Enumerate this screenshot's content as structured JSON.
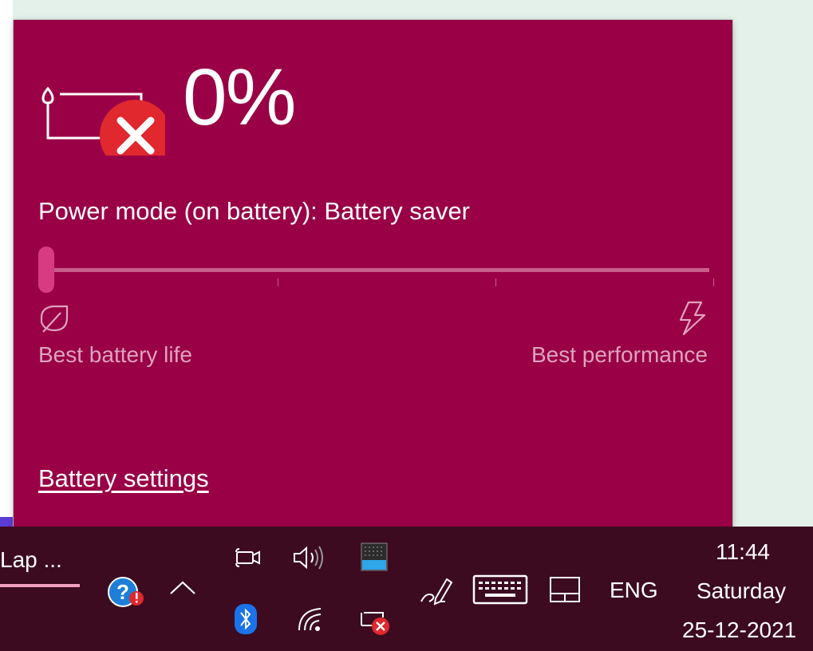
{
  "flyout": {
    "battery_percent": "0%",
    "power_mode_label": "Power mode (on battery): Battery saver",
    "slider_level": 0,
    "best_battery_life": "Best battery life",
    "best_performance": "Best performance",
    "battery_settings_link": "Battery settings",
    "accent_color": "#990046",
    "error_color": "#e0282e"
  },
  "taskbar": {
    "app_label": "Lap ...",
    "language": "ENG",
    "time": "11:44",
    "day": "Saturday",
    "date": "25-12-2021",
    "icons": [
      "help-warning-icon",
      "chevron-up-icon",
      "camera-icon",
      "volume-icon",
      "storage-icon",
      "bluetooth-icon",
      "wifi-icon",
      "battery-error-icon",
      "pen-icon",
      "keyboard-icon",
      "touchpad-icon"
    ]
  }
}
